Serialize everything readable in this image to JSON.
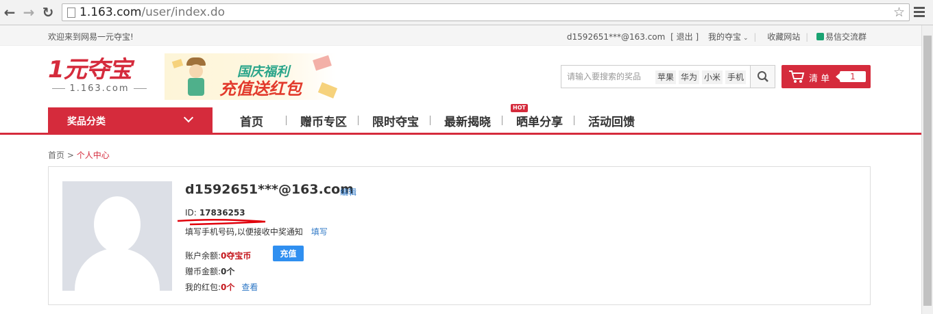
{
  "browser": {
    "back": "←",
    "forward": "→",
    "reload": "↻",
    "url_host": "1.163.com",
    "url_path": "/user/index.do"
  },
  "topbar": {
    "welcome": "欢迎来到网易一元夺宝!",
    "user": "d1592651***@163.com",
    "logout": "[ 退出 ]",
    "my_treasure": "我的夺宝",
    "favorite": "收藏网站",
    "yixin": "易信交流群"
  },
  "logo": {
    "main": "1元夺宝",
    "sub": "1.163.com"
  },
  "banner": {
    "line1": "国庆福利",
    "line2": "充值送红包"
  },
  "search": {
    "placeholder": "请输入要搜索的奖品",
    "hot": [
      "苹果",
      "华为",
      "小米",
      "手机"
    ]
  },
  "cart": {
    "label": "清 单",
    "count": "1"
  },
  "nav": {
    "category": "奖品分类",
    "items": [
      "首页",
      "赠币专区",
      "限时夺宝",
      "最新揭晓",
      "晒单分享",
      "活动回馈"
    ],
    "hot_badge": "HOT"
  },
  "breadcrumb": {
    "home": "首页",
    "sep": " > ",
    "current": "个人中心"
  },
  "profile": {
    "email": "d1592651***@163.com",
    "edit": "编辑",
    "id_label": "ID:",
    "id_value": "17836253",
    "phone_note": "填写手机号码,以便接收中奖通知",
    "phone_link": "填写",
    "balance_label": "账户余额:",
    "balance_value": "0夺宝币",
    "recharge": "充值",
    "coins_label": "赠币金额:",
    "coins_value": "0个",
    "redpack_label": "我的红包:",
    "redpack_value": "0个",
    "view": "查看"
  },
  "colors": {
    "brand_red": "#d52b3c",
    "link_blue": "#2f78c6",
    "button_blue": "#2f8ff0"
  }
}
